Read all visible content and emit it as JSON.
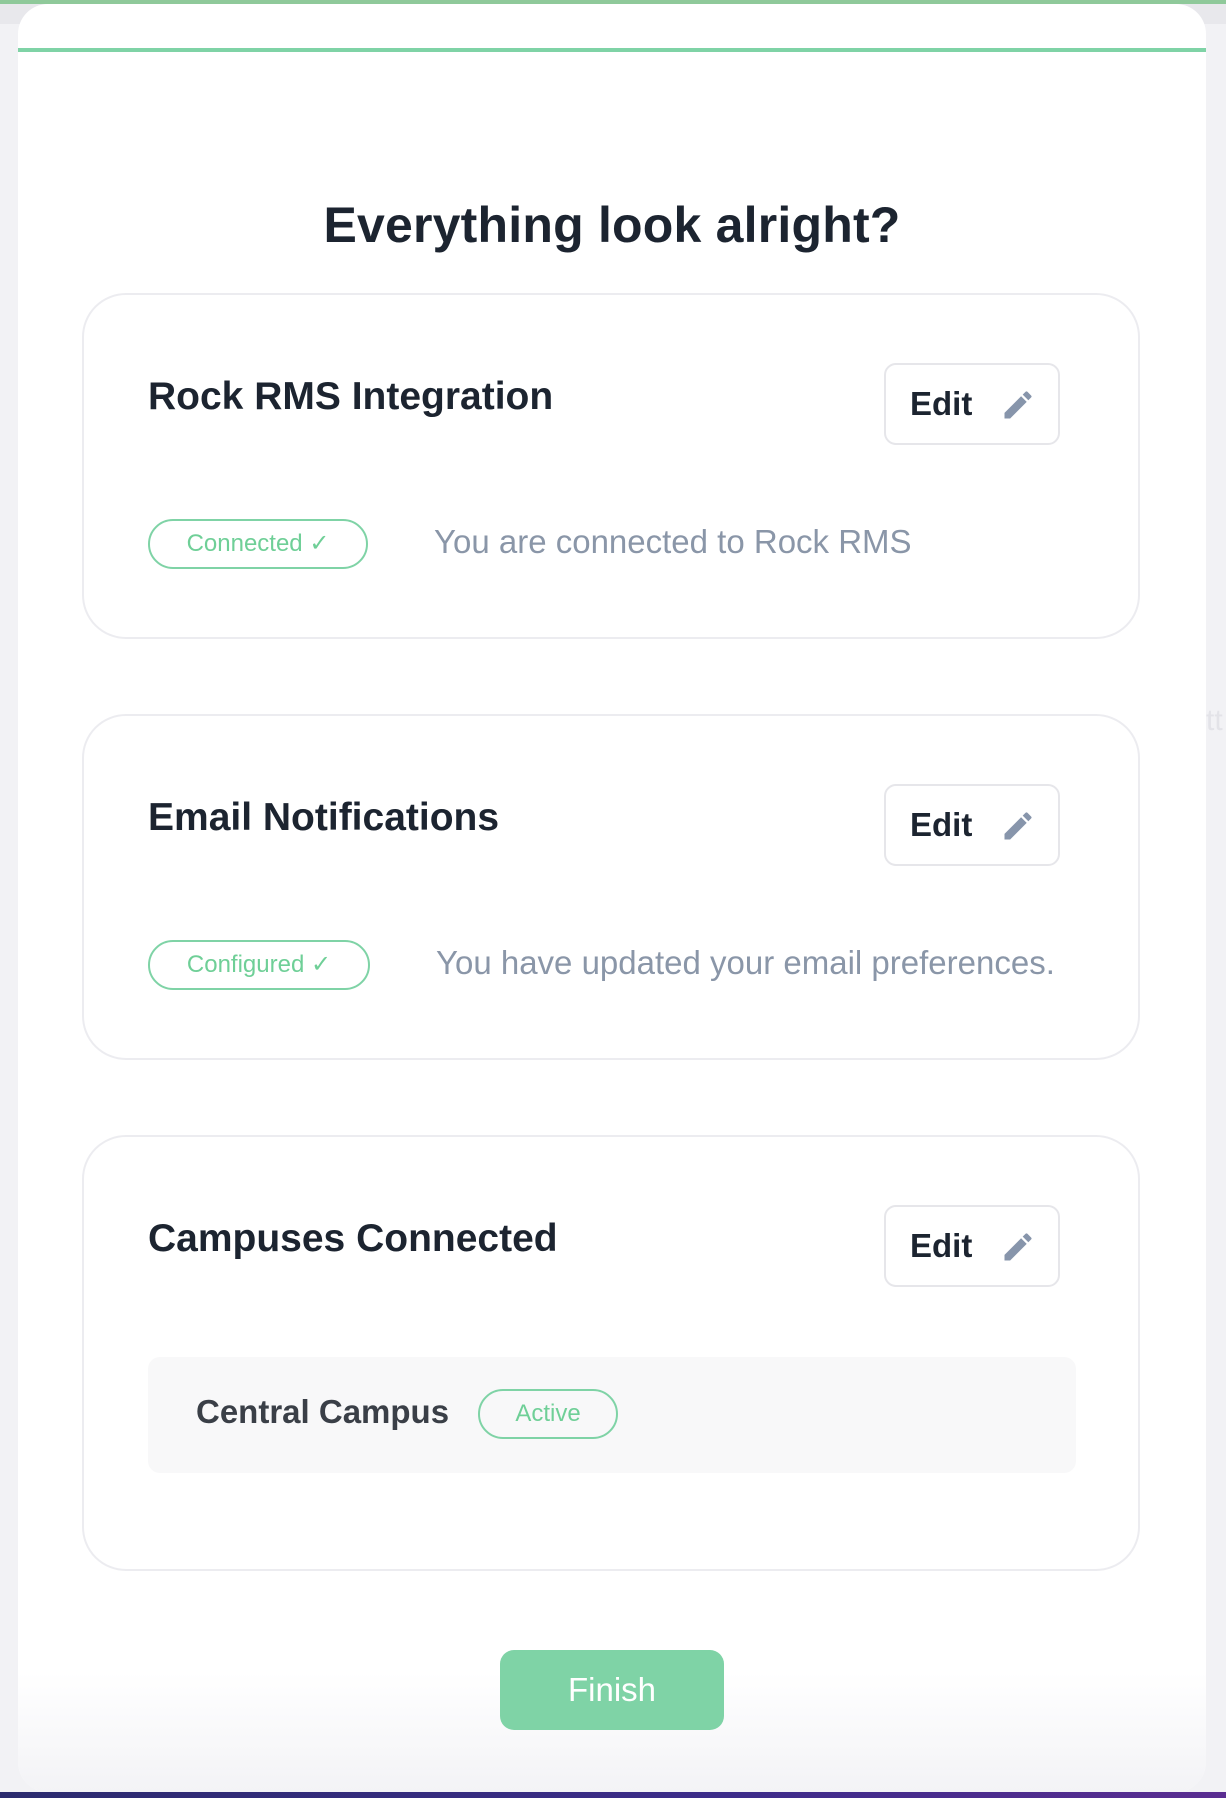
{
  "page": {
    "title": "Everything look alright?"
  },
  "cards": [
    {
      "title": "Rock RMS Integration",
      "edit_label": "Edit",
      "status": "Connected ✓",
      "description": "You are connected to Rock RMS"
    },
    {
      "title": "Email Notifications",
      "edit_label": "Edit",
      "status": "Configured ✓",
      "description": "You have updated your email preferences."
    },
    {
      "title": "Campuses Connected",
      "edit_label": "Edit",
      "campus": {
        "name": "Central Campus",
        "status": "Active"
      }
    }
  ],
  "finish_label": "Finish",
  "colors": {
    "accent": "#7fd3a6",
    "accent_text": "#6fcf97",
    "title_text": "#1c2430",
    "muted_text": "#8a96a8"
  },
  "icons": {
    "edit": "pencil-icon"
  }
}
